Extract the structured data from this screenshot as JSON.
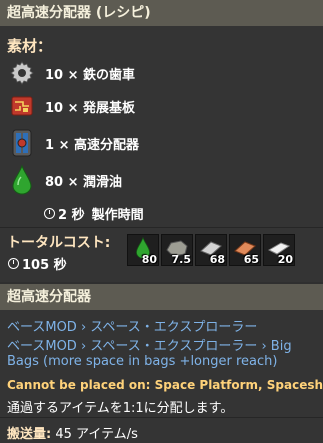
{
  "recipe_panel": {
    "title": "超高速分配器 (レシピ)",
    "ingredients_heading": "素材：",
    "ingredients": [
      {
        "icon": "gear-icon",
        "amount": "10",
        "name": "鉄の歯車"
      },
      {
        "icon": "circuit-board-icon",
        "amount": "10",
        "name": "発展基板"
      },
      {
        "icon": "express-splitter-icon",
        "amount": "1",
        "name": "高速分配器"
      },
      {
        "icon": "lubricant-drop-icon",
        "amount": "80",
        "name": "潤滑油"
      }
    ],
    "craft_time_value": "2 秒",
    "craft_time_label": "製作時間",
    "total_cost_label": "トータルコスト:",
    "total_time": "105 秒",
    "total_items": [
      {
        "icon": "lubricant-drop-icon",
        "count": "80"
      },
      {
        "icon": "stone-ore-icon",
        "count": "7.5"
      },
      {
        "icon": "iron-plate-icon",
        "count": "68"
      },
      {
        "icon": "copper-plate-icon",
        "count": "65"
      },
      {
        "icon": "plastic-bar-icon",
        "count": "20"
      }
    ]
  },
  "item_panel": {
    "title": "超高速分配器",
    "mods_line1": "ベースMOD › スペース・エクスプローラー",
    "mods_line2a": "ベースMOD › スペース・エクスプローラー › Big",
    "mods_line2b": "Bags (more space in bags +longer reach)",
    "placement_note": "Cannot be placed on: Space Platform, Spaceship",
    "description": "通過するアイテムを1:1に分配します。",
    "throughput_label": "搬送量:",
    "throughput_value": "45 アイテム/s"
  },
  "colors": {
    "heading": "#ffe6c0",
    "link": "#7fb3e8",
    "warning": "#ffd27a"
  }
}
